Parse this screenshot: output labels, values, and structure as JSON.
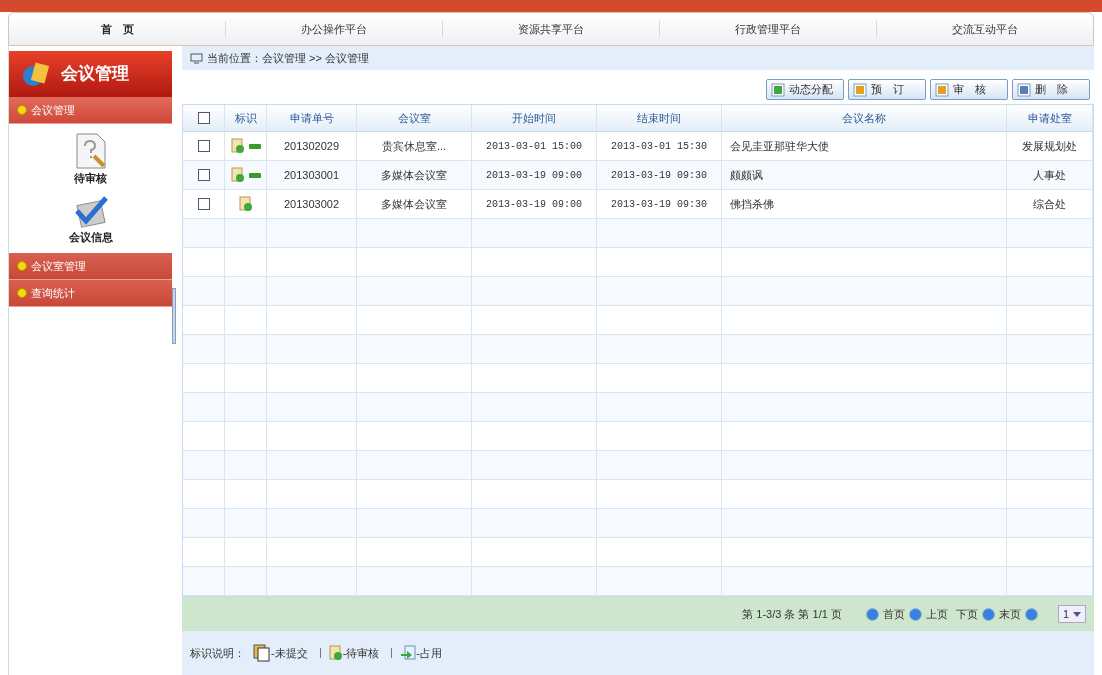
{
  "top_nav": [
    {
      "label": "首　页",
      "selected": true
    },
    {
      "label": "办公操作平台",
      "selected": false
    },
    {
      "label": "资源共享平台",
      "selected": false
    },
    {
      "label": "行政管理平台",
      "selected": false
    },
    {
      "label": "交流互动平台",
      "selected": false
    }
  ],
  "sidebar": {
    "title": "会议管理",
    "sections": [
      {
        "label": "会议管理",
        "expanded": true,
        "items": [
          {
            "label": "待审核",
            "kind": "pending"
          },
          {
            "label": "会议信息",
            "kind": "check"
          }
        ]
      },
      {
        "label": "会议室管理",
        "expanded": false
      },
      {
        "label": "查询统计",
        "expanded": false
      }
    ]
  },
  "breadcrumb": "当前位置：会议管理 >> 会议管理",
  "toolbar": [
    {
      "label": "动态分配",
      "kind": "assign"
    },
    {
      "label": "预　订",
      "kind": "book"
    },
    {
      "label": "审　核",
      "kind": "review"
    },
    {
      "label": "删　除",
      "kind": "delete"
    }
  ],
  "table": {
    "select_all_checked": false,
    "columns": [
      "",
      "标识",
      "申请单号",
      "会议室",
      "开始时间",
      "结束时间",
      "会议名称",
      "申请处室"
    ],
    "rows": [
      {
        "checked": false,
        "kind": "pending",
        "tagged": true,
        "cells": [
          "",
          "",
          "201302029",
          "贵宾休息室...",
          "2013-03-01 15:00",
          "2013-03-01 15:30",
          "会见圭亚那驻华大使",
          "发展规划处"
        ]
      },
      {
        "checked": false,
        "kind": "pending",
        "tagged": true,
        "cells": [
          "",
          "",
          "201303001",
          "多媒体会议室",
          "2013-03-19 09:00",
          "2013-03-19 09:30",
          "颇颇讽",
          "人事处"
        ]
      },
      {
        "checked": false,
        "kind": "pending",
        "tagged": false,
        "cells": [
          "",
          "",
          "201303002",
          "多媒体会议室",
          "2013-03-19 09:00",
          "2013-03-19 09:30",
          "佛挡杀佛",
          "综合处"
        ]
      }
    ]
  },
  "pagination": {
    "summary": "第 1-3/3 条 第 1/1 页",
    "first": "首页",
    "prev": "上页",
    "next": "下页",
    "last": "末页",
    "page": "1"
  },
  "legend": {
    "title": "标识说明：",
    "items": [
      {
        "label": "-未提交",
        "kind": "draft"
      },
      {
        "label": "-待审核",
        "kind": "pending"
      },
      {
        "label": "-占用",
        "kind": "occupied"
      }
    ]
  }
}
